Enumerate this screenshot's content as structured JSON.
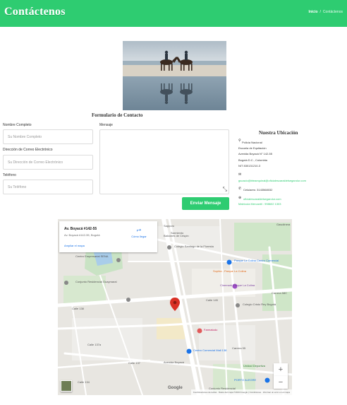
{
  "header": {
    "title": "Contáctenos",
    "breadcrumb_home": "Inicio",
    "breadcrumb_sep": "/",
    "breadcrumb_current": "Contáctenos"
  },
  "form": {
    "title": "Formulario de Contacto",
    "name_label": "Nombre Completo",
    "name_placeholder": "Su Nombre Completo",
    "email_label": "Dirección de Correo Electrónico",
    "email_placeholder": "Su Dirección de Correo Electrónico",
    "phone_label": "Teléfono",
    "phone_placeholder": "Su Teléfono",
    "message_label": "Mensaje",
    "submit_label": "Enviar Mensaje"
  },
  "location": {
    "title": "Nuestra Ubicación",
    "org": "Policía Nacional",
    "school": "Escuela de Equitación",
    "address": "Avenida Boyacá N° 142-55",
    "city": "Bogotá D.C., Colombia",
    "nit": "NIT 830131210-3",
    "email": "gsoacic@bteaequinal@oficialescaraldelsegaroiur.com",
    "phone": "Celulares: 3143568032",
    "link1": "oficialescaraldelsegaroiur.com",
    "link2": "Matrícula Mercantil : 998602 1303"
  },
  "map": {
    "card_title": "Av. Boyacá #142-55",
    "card_subtitle": "Av. Boyacá #142-55, Bogotá",
    "card_link": "Ampliar el mapa",
    "directions_label": "Cómo llegar",
    "zoom_in": "+",
    "zoom_out": "−",
    "google": "Google",
    "attribution": "Combinaciones de teclas · Datos del mapa ©2024 Google | Condiciones · Informar un error en el mapa",
    "labels": {
      "sapporo": "Sapporo",
      "balcones": "Balcones de Crispin",
      "gasolinera": "Gasolinera",
      "sarmiento": "Sarmiento",
      "colegio_santiago": "Colegio Santiago de la Floresta",
      "sena": "Centro Empresarial SENA",
      "parque_colina": "Parque La Colina Centro Comercial",
      "sophia": "Sophia - Parque La Colina",
      "cinemark": "Cinemark Parque La Colina",
      "residencial_guaymaral": "Conjunto Residencial Guaymaral",
      "colegio_cristo": "Colegio Cristo Rey Bogotá",
      "farmatodo": "Farmatodo",
      "mall138": "Centro Comercial Mall 138",
      "conjunto_residencial": "Conjunto Residencial",
      "porto_alegre": "PORTO ALEGRE",
      "calle138": "Calle 138",
      "calle137a": "Calle 137a",
      "calle137": "Calle 137",
      "calle145": "Calle 145",
      "calle134": "Calle 134",
      "carrera58c": "Carrera 58C",
      "carrera55": "Carrera 55",
      "av_boyaca": "Avenida Boyacá",
      "unidad_deportiva": "Unidad Deportiva"
    }
  },
  "colors": {
    "accent": "#2ecc71",
    "link_blue": "#1a73e8",
    "pin_red": "#d93025"
  }
}
